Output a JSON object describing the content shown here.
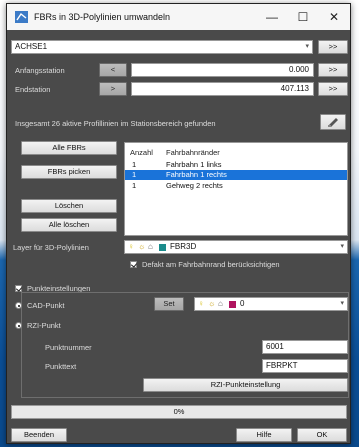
{
  "window": {
    "title": "FBRs in 3D-Polylinien umwandeln",
    "minimize": "—",
    "maximize": "☐",
    "close": "✕"
  },
  "axis": {
    "value": "ACHSE1",
    "more_label": ">>"
  },
  "start": {
    "label": "Anfangsstation",
    "pick_label": "<",
    "value": "0.000",
    "more_label": ">>"
  },
  "end": {
    "label": "Endstation",
    "pick_label": ">",
    "value": "407.113",
    "more_label": ">>"
  },
  "status_text": "Insgesamt 26 aktive Profillinien im Stationsbereich gefunden",
  "buttons": {
    "all_fbrs": "Alle FBRs",
    "pick_fbrs": "FBRs picken",
    "delete": "Löschen",
    "delete_all": "Alle löschen"
  },
  "list": {
    "col_count": "Anzahl",
    "col_name": "Fahrbahnränder",
    "rows": [
      {
        "count": "1",
        "name": "Fahrbahn 1 links",
        "selected": false
      },
      {
        "count": "1",
        "name": "Fahrbahn 1 rechts",
        "selected": true
      },
      {
        "count": "1",
        "name": "Gehweg 2 rechts",
        "selected": false
      }
    ]
  },
  "layer": {
    "label": "Layer für 3D-Polylinien",
    "value": "FBR3D"
  },
  "default_checkbox": {
    "label": "Defakt am Fahrbahnrand berücksichtigen",
    "checked": true
  },
  "point_settings": {
    "checkbox_label": "Punkteinstellungen",
    "checked": true,
    "cad_radio": "CAD-Punkt",
    "cad_selected": true,
    "set_button": "Set",
    "layer_value": "0",
    "rzi_radio": "RZI-Punkt",
    "rzi_selected": true,
    "point_number_label": "Punktnummer",
    "point_number_value": "6001",
    "point_text_label": "Punkttext",
    "point_text_value": "FBRPKT",
    "rzi_settings_button": "RZI-Punkteinstellung"
  },
  "progress": {
    "text": "0%",
    "fraction": 0.0
  },
  "footer": {
    "exit": "Beenden",
    "help": "Hilfe",
    "ok": "OK"
  },
  "colors": {
    "dialog_bg": "#4a4a4a",
    "selection": "#1a73d9",
    "layer_swatch_teal": "#1b8c8c",
    "layer_swatch_magenta": "#b0135f"
  }
}
